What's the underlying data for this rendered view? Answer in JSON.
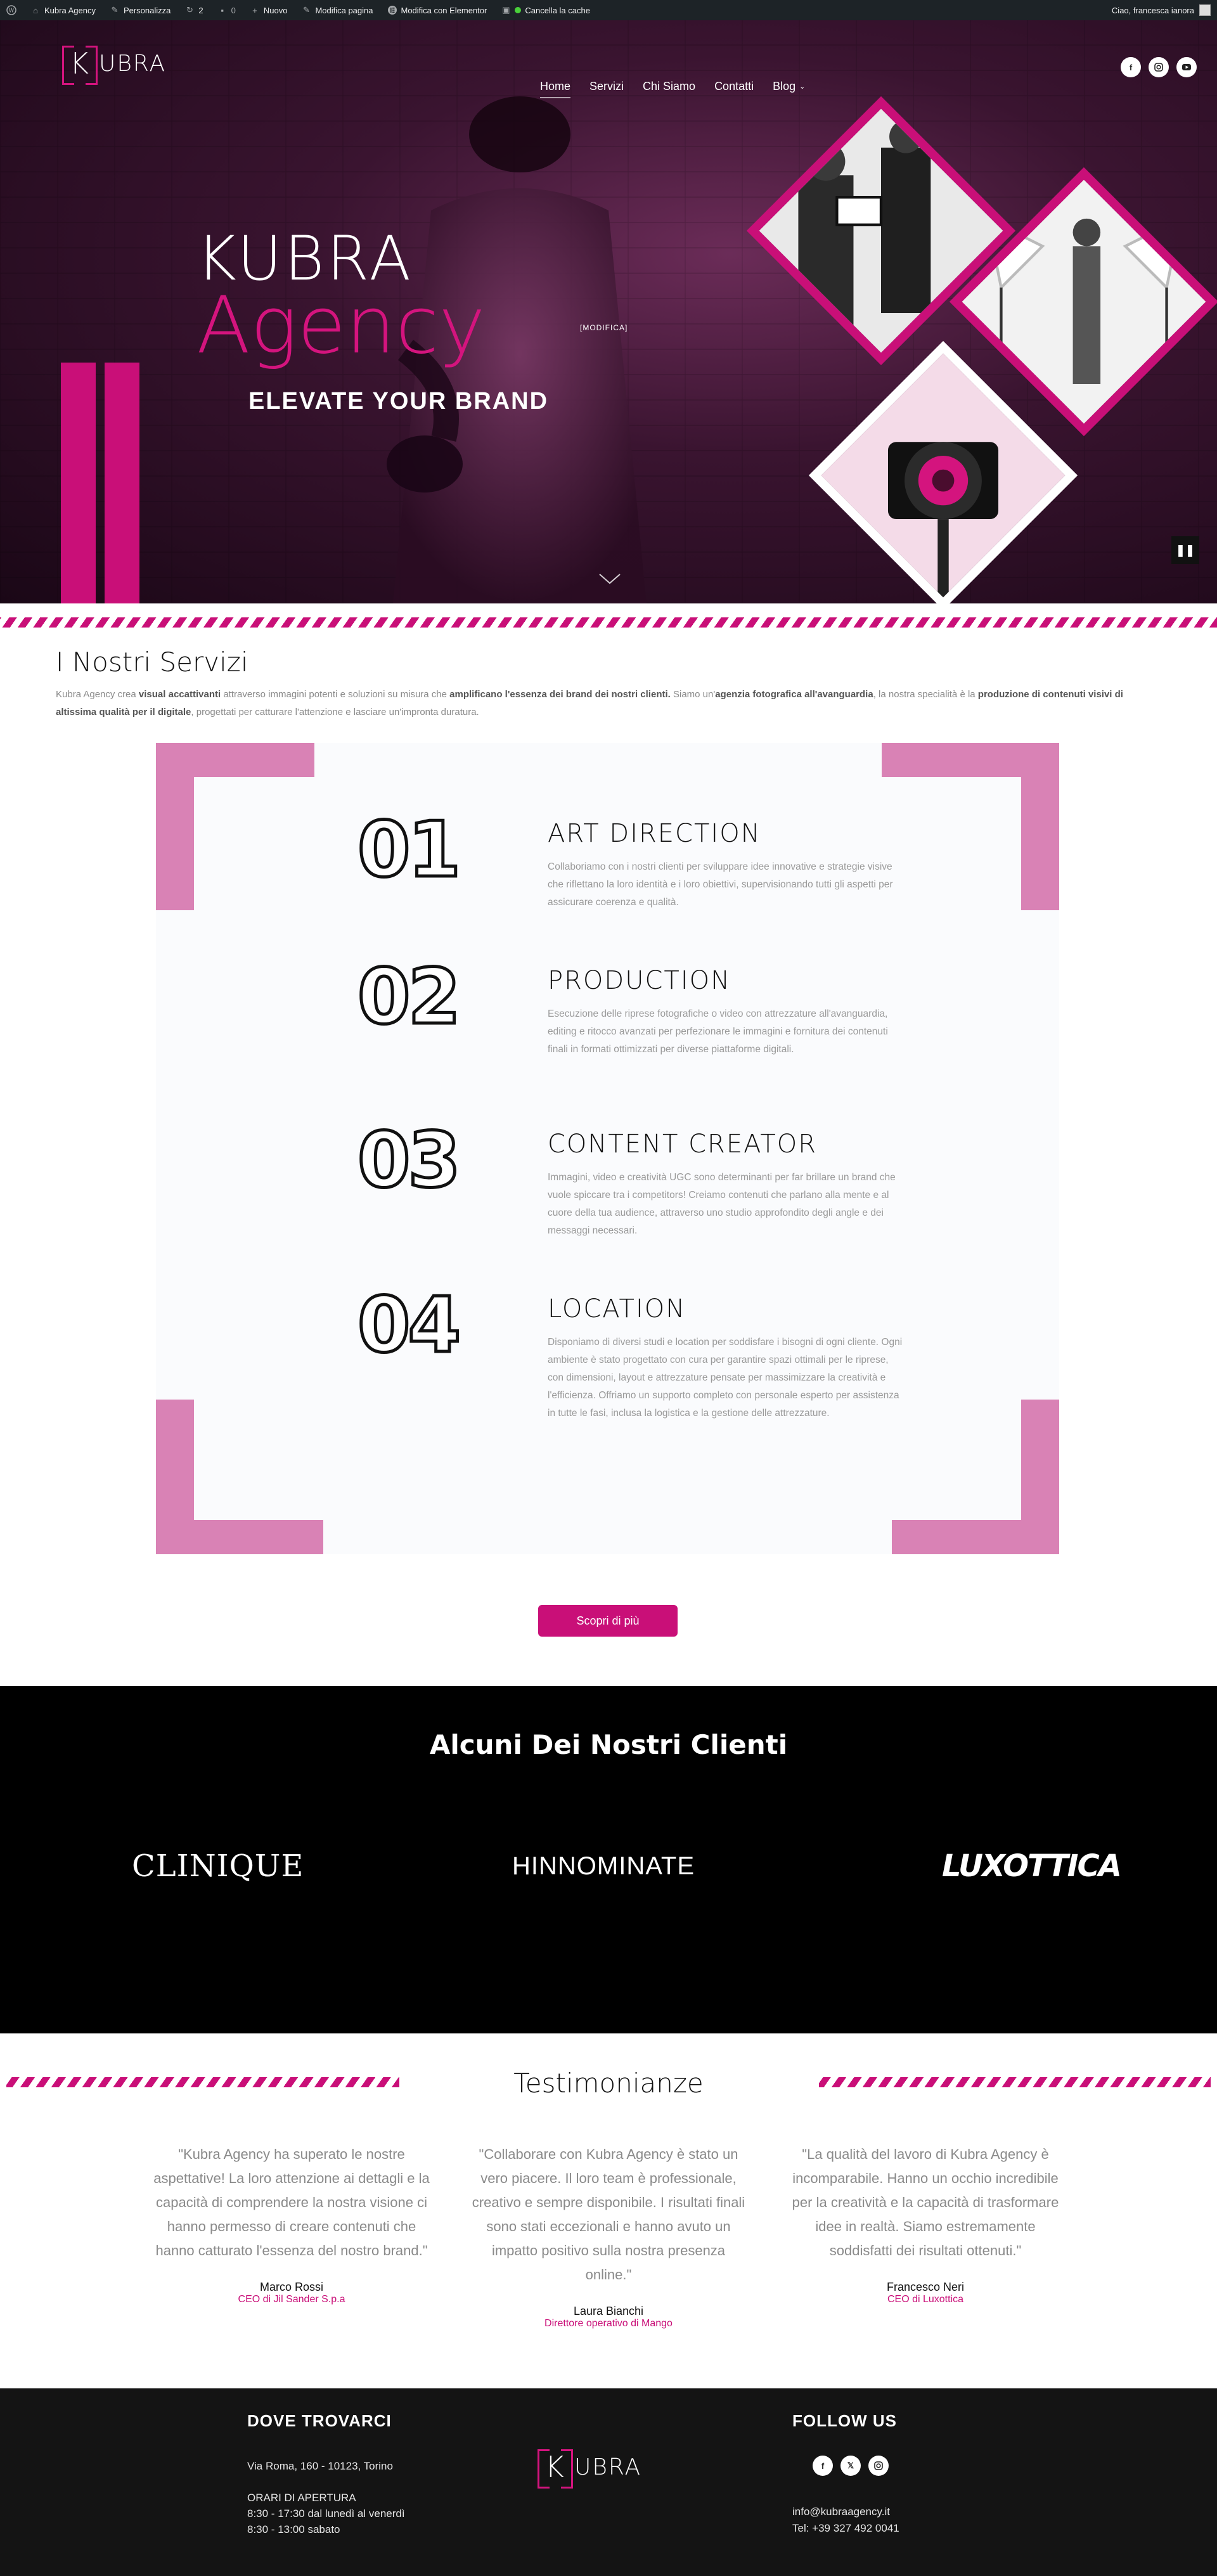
{
  "admin_bar": {
    "site_name": "Kubra Agency",
    "customize": "Personalizza",
    "updates_count": "2",
    "comments_count": "0",
    "new": "Nuovo",
    "edit_page": "Modifica pagina",
    "edit_elementor": "Modifica con Elementor",
    "clear_cache": "Cancella la cache",
    "greeting": "Ciao, francesca ianora"
  },
  "brand": {
    "logo_k": "K",
    "logo_rest": "UBRA"
  },
  "nav": {
    "items": [
      {
        "label": "Home"
      },
      {
        "label": "Servizi"
      },
      {
        "label": "Chi Siamo"
      },
      {
        "label": "Contatti"
      },
      {
        "label": "Blog"
      }
    ]
  },
  "hero": {
    "title_line1": "KUBRA",
    "title_line2": "Agency",
    "edit_link": "[MODIFICA]",
    "subtitle": "ELEVATE YOUR BRAND"
  },
  "services": {
    "title": "I Nostri Servizi",
    "intro": {
      "p1": "Kubra Agency crea ",
      "b1": "visual accattivanti",
      "p2": " attraverso immagini potenti e soluzioni su misura che ",
      "b2": "amplificano l'essenza dei brand dei nostri clienti.",
      "p3": " Siamo un'",
      "b3": "agenzia fotografica all'avanguardia",
      "p4": ", la nostra specialità è la ",
      "b4": "produzione di contenuti visivi di altissima qualità per il digitale",
      "p5": ", progettati per catturare l'attenzione e lasciare un'impronta duratura."
    },
    "items": [
      {
        "num": "01",
        "title": "ART DIRECTION",
        "desc": "Collaboriamo con i nostri clienti per sviluppare idee innovative e strategie visive che riflettano la loro identità e i loro obiettivi, supervisionando tutti gli aspetti per assicurare coerenza e qualità."
      },
      {
        "num": "02",
        "title": "PRODUCTION",
        "desc": "Esecuzione delle riprese fotografiche o video con attrezzature all'avanguardia, editing e ritocco avanzati per perfezionare le immagini e fornitura dei contenuti finali in formati ottimizzati per diverse piattaforme digitali."
      },
      {
        "num": "03",
        "title": "CONTENT CREATOR",
        "desc": "Immagini, video e creatività UGC sono determinanti per far brillare un brand che vuole spiccare tra i competitors! Creiamo contenuti che parlano alla mente e al cuore della tua audience, attraverso uno studio approfondito degli angle e dei messaggi necessari."
      },
      {
        "num": "04",
        "title": "LOCATION",
        "desc": "Disponiamo di diversi studi e location per soddisfare i bisogni di ogni cliente. Ogni ambiente è stato progettato con cura per garantire spazi ottimali per le riprese, con dimensioni, layout e attrezzature pensate per massimizzare la creatività e l'efficienza. Offriamo un supporto completo con personale esperto per assistenza in tutte le fasi, inclusa la logistica e la gestione delle attrezzature."
      }
    ],
    "cta": "Scopri di più"
  },
  "clients": {
    "title": "Alcuni Dei Nostri Clienti",
    "logos": [
      "CLINIQUE",
      "HINNOMINATE",
      "LUXOTTICA"
    ]
  },
  "testimonials": {
    "title": "Testimonianze",
    "items": [
      {
        "quote": "\"Kubra Agency ha superato le nostre aspettative! La loro attenzione ai dettagli e la capacità di comprendere la nostra visione ci hanno permesso di creare contenuti che hanno catturato l'essenza del nostro brand.\"",
        "name": "Marco Rossi",
        "role": "CEO di Jil Sander S.p.a"
      },
      {
        "quote": "\"Collaborare con Kubra Agency è stato un vero piacere. Il loro team è professionale, creativo e sempre disponibile. I risultati finali sono stati eccezionali e hanno avuto un impatto positivo sulla nostra presenza online.\"",
        "name": "Laura Bianchi",
        "role": "Direttore operativo di Mango"
      },
      {
        "quote": "\"La qualità del lavoro di Kubra Agency è incomparabile. Hanno un occhio incredibile per la creatività e la capacità di trasformare idee in realtà. Siamo estremamente soddisfatti dei risultati ottenuti.\"",
        "name": "Francesco Neri",
        "role": "CEO di Luxottica"
      }
    ]
  },
  "footer": {
    "where_title": "DOVE TROVARCI",
    "address": "Via Roma, 160 - 10123, Torino",
    "hours_title": "ORARI DI APERTURA",
    "hours_week": "8:30 - 17:30 dal lunedì al venerdì",
    "hours_sat": "8:30 - 13:00 sabato",
    "follow_title": "FOLLOW US",
    "email": "info@kubraagency.it",
    "phone": "Tel: +39 327 492 0041"
  },
  "colors": {
    "accent": "#c90f78",
    "corner": "#d982b5",
    "dark": "#141414"
  },
  "icons": [
    "wordpress-icon",
    "home-icon",
    "brush-icon",
    "refresh-icon",
    "comment-icon",
    "plus-icon",
    "pencil-icon",
    "elementor-icon",
    "facebook-icon",
    "instagram-icon",
    "youtube-icon",
    "x-icon",
    "chevron-down-icon",
    "pause-icon"
  ]
}
